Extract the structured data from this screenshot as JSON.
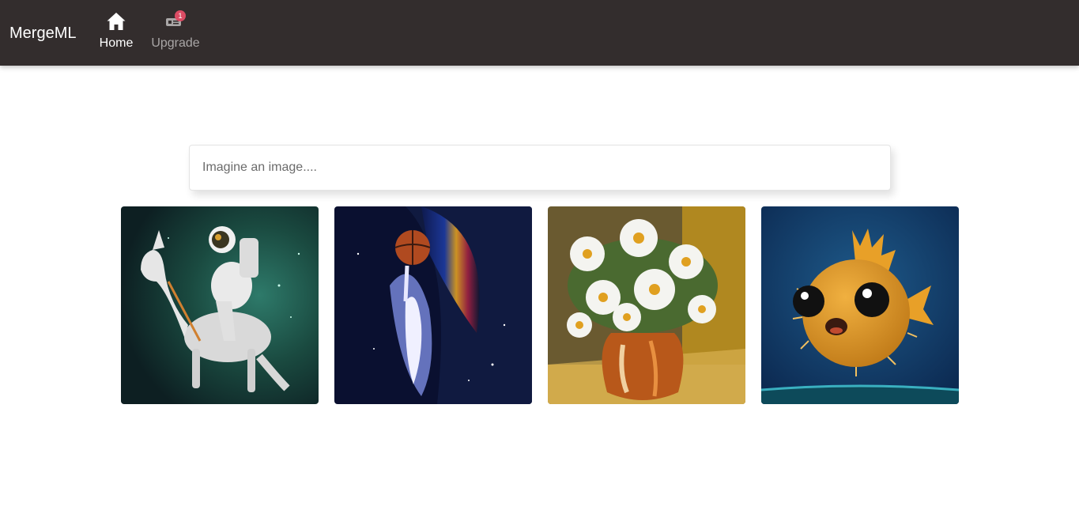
{
  "navbar": {
    "brand": "MergeML",
    "items": [
      {
        "label": "Home",
        "icon": "home-icon",
        "active": true
      },
      {
        "label": "Upgrade",
        "icon": "ticket-icon",
        "badge": "1"
      }
    ]
  },
  "search": {
    "placeholder": "Imagine an image....",
    "value": ""
  },
  "gallery": [
    {
      "subject": "astronaut-riding-horse-image"
    },
    {
      "subject": "nebula-basketball-player-image"
    },
    {
      "subject": "daisies-vase-painting-image"
    },
    {
      "subject": "pufferfish-image"
    }
  ],
  "colors": {
    "navbar_bg": "#332d2d",
    "badge": "#dc4c64",
    "nav_inactive": "#a9a6a6"
  }
}
